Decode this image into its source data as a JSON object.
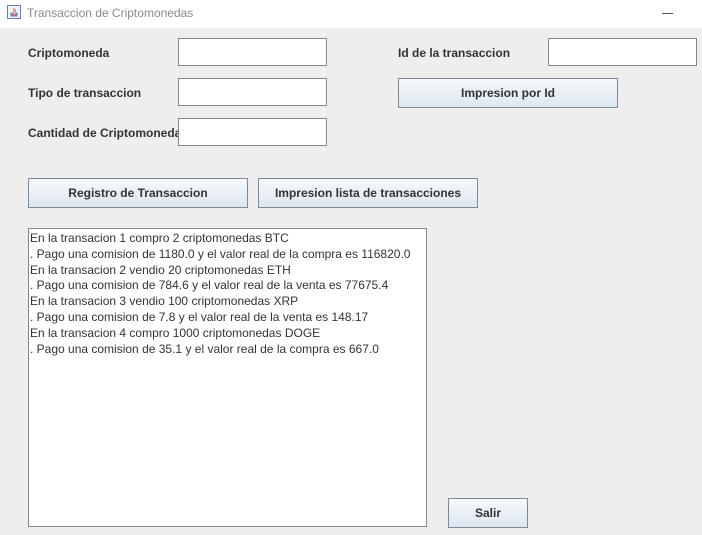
{
  "window": {
    "title": "Transaccion de Criptomonedas"
  },
  "form": {
    "criptomoneda_label": "Criptomoneda",
    "tipo_label": "Tipo de transaccion",
    "cantidad_label": "Cantidad de Criptomoneda",
    "id_label": "Id de la transaccion",
    "criptomoneda_value": "",
    "tipo_value": "",
    "cantidad_value": "",
    "id_value": ""
  },
  "buttons": {
    "impresion_por_id": "Impresion por Id",
    "registro": "Registro de Transaccion",
    "impresion_lista": "Impresion lista de transacciones",
    "salir": "Salir"
  },
  "output": {
    "lines": [
      "En la transacion 1 compro 2 criptomonedas BTC",
      ". Pago una comision de 1180.0 y el valor real de la compra es 116820.0",
      "En la transacion 2 vendio 20 criptomonedas ETH",
      ". Pago una comision de 784.6 y el valor real de la venta es 77675.4",
      "En la transacion 3 vendio 100 criptomonedas XRP",
      ". Pago una comision de 7.8 y el valor real de la venta es 148.17",
      "En la transacion 4 compro 1000 criptomonedas DOGE",
      ". Pago una comision de 35.1 y el valor real de la compra es 667.0"
    ]
  }
}
